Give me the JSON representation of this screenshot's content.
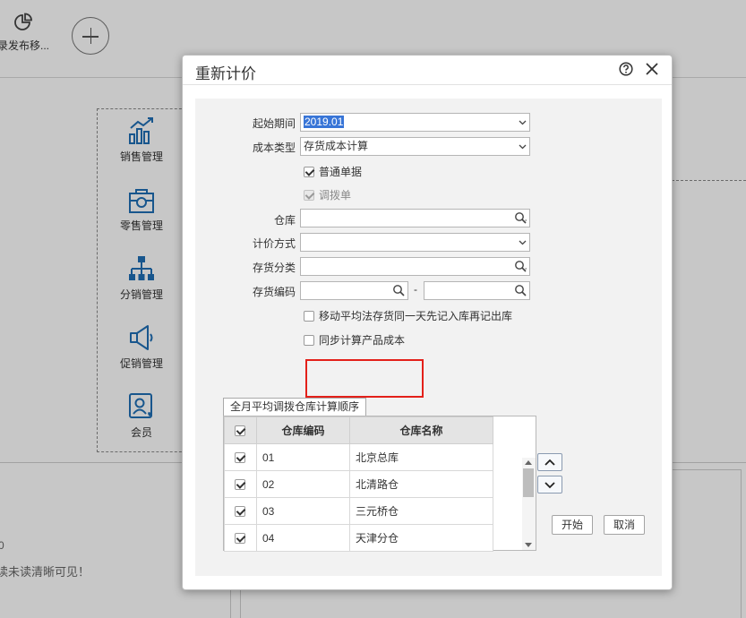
{
  "background": {
    "top_item_label": "录发布移...",
    "nav": [
      {
        "label": "销售管理",
        "icon": "bar-chart-icon"
      },
      {
        "label": "零售管理",
        "icon": "retail-bag-icon"
      },
      {
        "label": "分销管理",
        "icon": "org-tree-icon"
      },
      {
        "label": "促销管理",
        "icon": "megaphone-icon"
      },
      {
        "label": "会员",
        "icon": "member-card-icon"
      }
    ],
    "bottom_dot": "0",
    "bottom_hint": "读未读清晰可见！"
  },
  "dialog": {
    "title": "重新计价",
    "fields": {
      "start_period_label": "起始期间",
      "start_period_value": "2019.01",
      "cost_type_label": "成本类型",
      "cost_type_value": "存货成本计算",
      "normal_doc_label": "普通单据",
      "transfer_doc_label": "调拨单",
      "warehouse_label": "仓库",
      "warehouse_value": "",
      "pricing_method_label": "计价方式",
      "pricing_method_value": "",
      "inventory_category_label": "存货分类",
      "inventory_category_value": "",
      "inventory_code_label": "存货编码",
      "inventory_code_from": "",
      "range_separator": "-",
      "inventory_code_to": "",
      "moving_avg_label": "移动平均法存货同一天先记入库再记出库",
      "sync_product_cost_label": "同步计算产品成本"
    },
    "checkbox_state": {
      "normal_doc": true,
      "transfer_doc": true,
      "moving_avg": false,
      "sync_product_cost": false
    },
    "tab_label": "全月平均调拨仓库计算顺序",
    "table": {
      "headers": [
        "仓库编码",
        "仓库名称"
      ],
      "rows": [
        {
          "code": "01",
          "name": "北京总库",
          "checked": true
        },
        {
          "code": "02",
          "name": "北清路仓",
          "checked": true
        },
        {
          "code": "03",
          "name": "三元桥仓",
          "checked": true
        },
        {
          "code": "04",
          "name": "天津分仓",
          "checked": true
        }
      ]
    },
    "buttons": {
      "start": "开始",
      "cancel": "取消"
    },
    "colors": {
      "highlight_box": "#e3201a",
      "selection": "#3875d7",
      "nav_icon": "#1f6fb5"
    }
  }
}
